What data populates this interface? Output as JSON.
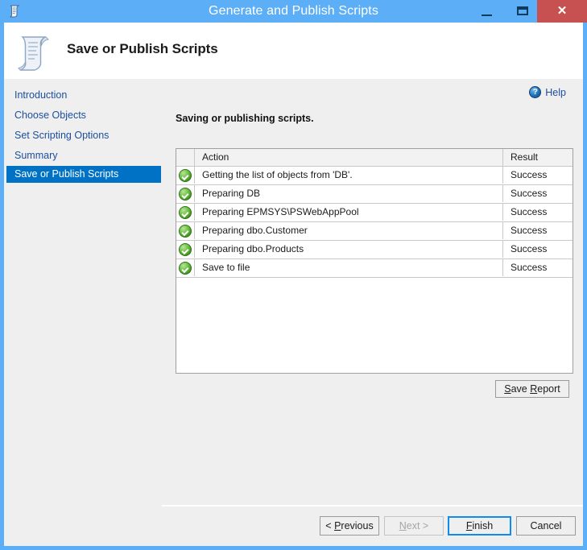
{
  "window": {
    "title": "Generate and Publish Scripts",
    "app_icon": "script-scroll-icon",
    "controls": {
      "minimize": "minimize-icon",
      "maximize": "maximize-icon",
      "close": "✕"
    },
    "frame_color": "#5caef7",
    "close_color": "#c75050"
  },
  "header": {
    "title": "Save or Publish Scripts",
    "icon": "script-scroll-icon"
  },
  "sidebar": {
    "items": [
      {
        "label": "Introduction",
        "selected": false
      },
      {
        "label": "Choose Objects",
        "selected": false
      },
      {
        "label": "Set Scripting Options",
        "selected": false
      },
      {
        "label": "Summary",
        "selected": false
      },
      {
        "label": "Save or Publish Scripts",
        "selected": true
      }
    ],
    "link_color": "#1b4f9c",
    "selected_color": "#0072c6"
  },
  "content": {
    "help_label": "Help",
    "help_icon": "help-circle-icon",
    "section_label": "Saving or publishing scripts.",
    "grid": {
      "columns": [
        "",
        "Action",
        "Result"
      ],
      "rows": [
        {
          "status": "success-icon",
          "action": "Getting the list of objects from 'DB'.",
          "result": "Success"
        },
        {
          "status": "success-icon",
          "action": "Preparing DB",
          "result": "Success"
        },
        {
          "status": "success-icon",
          "action": "Preparing EPMSYS\\PSWebAppPool",
          "result": "Success"
        },
        {
          "status": "success-icon",
          "action": "Preparing dbo.Customer",
          "result": "Success"
        },
        {
          "status": "success-icon",
          "action": "Preparing dbo.Products",
          "result": "Success"
        },
        {
          "status": "success-icon",
          "action": "Save to file",
          "result": "Success"
        }
      ]
    },
    "save_report_label": "Save Report"
  },
  "footer": {
    "previous_label": "< Previous",
    "next_label": "Next >",
    "finish_label": "Finish",
    "cancel_label": "Cancel"
  }
}
